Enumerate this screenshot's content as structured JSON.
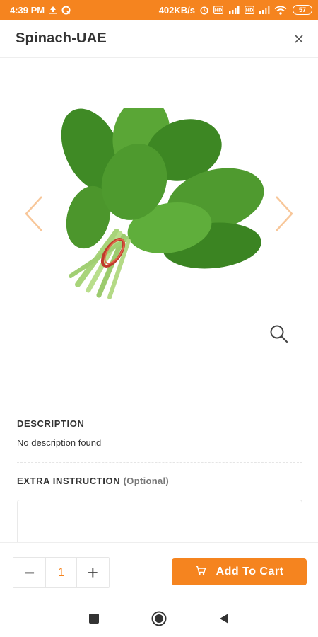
{
  "status_bar": {
    "time": "4:39 PM",
    "speed": "402KB/s",
    "battery": "57",
    "icons": [
      "upload-icon",
      "q-app-icon",
      "alarm-icon",
      "hd-icon",
      "signal-icon",
      "wifi-icon",
      "battery-icon"
    ]
  },
  "header": {
    "title": "Spinach-UAE",
    "close_icon": "close-icon"
  },
  "gallery": {
    "prev_icon": "chevron-left-icon",
    "next_icon": "chevron-right-icon",
    "zoom_icon": "search-icon",
    "image_subject": "spinach-bunch"
  },
  "description": {
    "title": "DESCRIPTION",
    "text": "No description found"
  },
  "extra_instruction": {
    "title": "EXTRA INSTRUCTION",
    "optional": "(Optional)",
    "value": ""
  },
  "cart": {
    "decrement": "−",
    "quantity": "1",
    "increment": "+",
    "add_label": "Add To Cart"
  },
  "colors": {
    "accent": "#f5841f",
    "arrow": "#f8c79a",
    "leaf": "#4f9a2f"
  }
}
